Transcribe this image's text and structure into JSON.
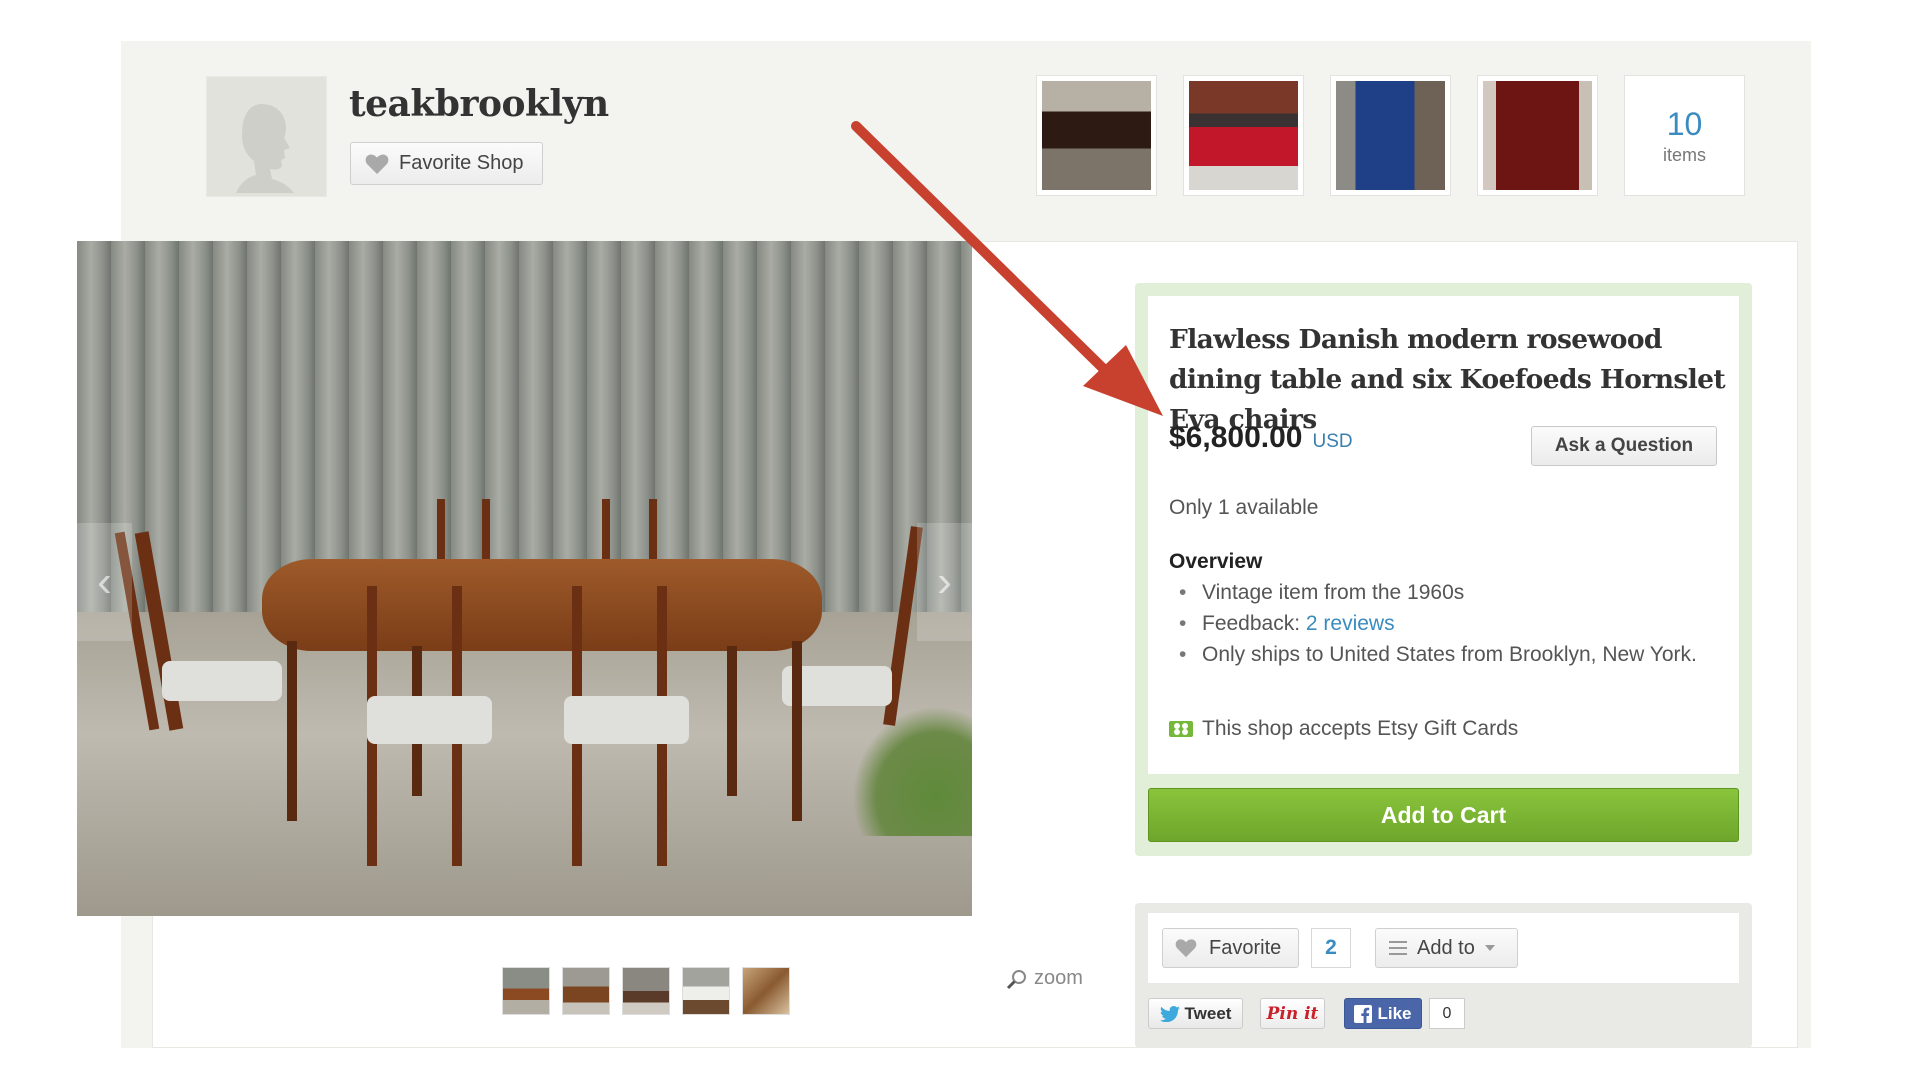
{
  "shop": {
    "name": "teakbrooklyn",
    "favorite_label": "Favorite Shop",
    "items_count": "10",
    "items_label": "items",
    "thumbnails": [
      "coffee-table",
      "red-sofa",
      "blue-armchair",
      "rosewood-cabinet"
    ]
  },
  "listing": {
    "title": "Flawless Danish modern rosewood dining table and six Koefoeds Hornslet Eva chairs",
    "price": "$6,800.00",
    "currency": "USD",
    "ask_label": "Ask a Question",
    "availability": "Only 1 available",
    "overview_heading": "Overview",
    "overview": {
      "vintage": "Vintage item from the 1960s",
      "feedback_prefix": "Feedback: ",
      "feedback_link": "2 reviews",
      "ships": "Only ships to United States from Brooklyn, New York."
    },
    "gift_cards": "This shop accepts Etsy Gift Cards",
    "add_to_cart": "Add to Cart"
  },
  "gallery": {
    "zoom_label": "zoom",
    "thumb_count": 5
  },
  "social": {
    "favorite_label": "Favorite",
    "favorite_count": "2",
    "add_to_label": "Add to",
    "tweet_label": "Tweet",
    "pin_label": "Pin it",
    "like_label": "Like",
    "like_count": "0"
  },
  "colors": {
    "accent_blue": "#3a8bbf",
    "cart_green": "#7bb534",
    "annotation_arrow": "#c0392b"
  }
}
